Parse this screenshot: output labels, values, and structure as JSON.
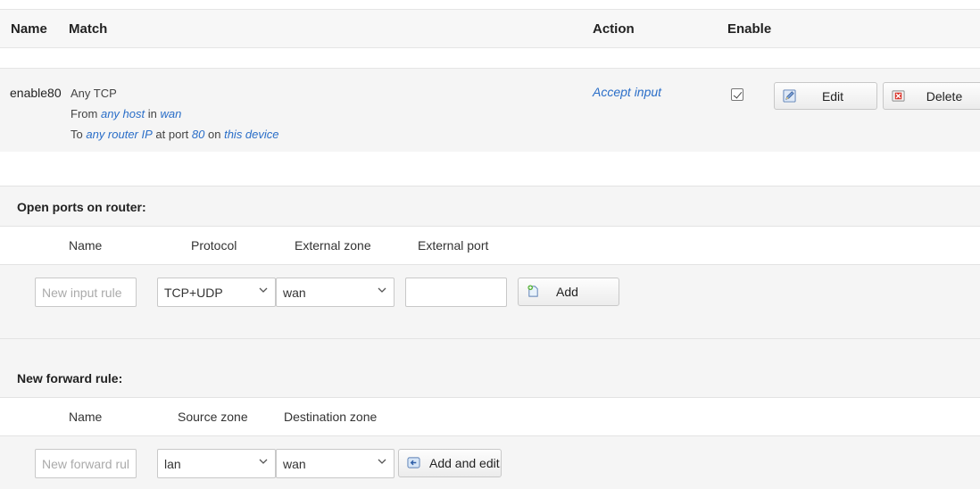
{
  "table": {
    "headers": {
      "name": "Name",
      "match": "Match",
      "action": "Action",
      "enable": "Enable"
    },
    "rule": {
      "name": "enable80",
      "proto": "Any TCP",
      "from_prefix": "From",
      "from_host": "any host",
      "from_in": "in",
      "from_zone": "wan",
      "to_prefix": "To",
      "to_ip": "any router IP",
      "to_at": "at port",
      "to_port": "80",
      "to_on": "on",
      "to_device": "this device",
      "action": "Accept input",
      "enabled": true,
      "edit_label": "Edit",
      "delete_label": "Delete"
    }
  },
  "open_ports": {
    "title": "Open ports on router:",
    "col_name": "Name",
    "col_protocol": "Protocol",
    "col_zone": "External zone",
    "col_port": "External port",
    "name_placeholder": "New input rule",
    "protocol_value": "TCP+UDP",
    "zone_value": "wan",
    "port_value": "",
    "add_label": "Add"
  },
  "forward": {
    "title": "New forward rule:",
    "col_name": "Name",
    "col_source": "Source zone",
    "col_dest": "Destination zone",
    "name_placeholder": "New forward rule",
    "source_value": "lan",
    "dest_value": "wan",
    "add_label": "Add and edit..."
  },
  "icons": {
    "edit": "edit-icon",
    "delete": "delete-icon",
    "add": "add-icon",
    "add_edit": "add-edit-icon",
    "chevron": "chevron-down-icon",
    "checkbox": "checkbox-checked-icon"
  },
  "colors": {
    "link": "#2a6ec8",
    "row_bg": "#f5f5f5",
    "header_bg": "#f7f7f7"
  }
}
